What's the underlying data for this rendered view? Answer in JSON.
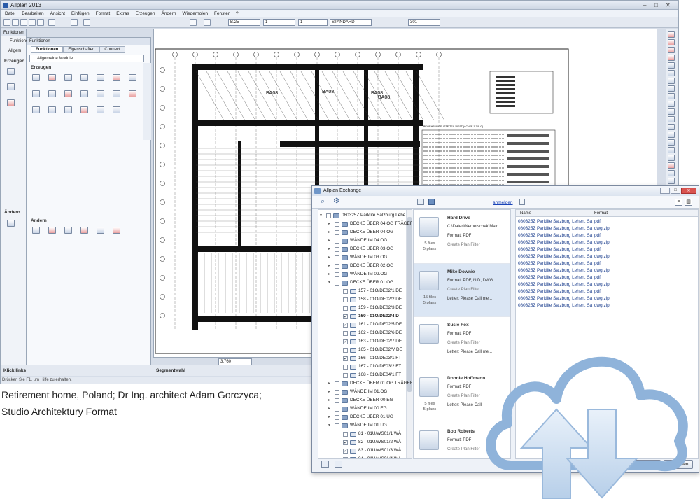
{
  "app": {
    "title": "Allplan 2013",
    "menu": [
      "Datei",
      "Bearbeiten",
      "Ansicht",
      "Einfügen",
      "Format",
      "Extras",
      "Erzeugen",
      "Ändern",
      "Wiederholen",
      "Fenster",
      "?"
    ],
    "toolbar": {
      "pen": "B.25",
      "line": "1",
      "color": "1",
      "layer": "STANDARD",
      "hatch": "301"
    },
    "status_hint": "Drücken Sie F1, um Hilfe zu erhalten.",
    "bottom_left": "Klick links",
    "bottom_mid": "Segmentwahl",
    "scale_value": "3.760"
  },
  "functions_panel": {
    "title": "Funktionen",
    "tab_left": "Funktionen",
    "side_tab": "Allgem",
    "float_title": "Funktionen",
    "tabs": [
      "Funktionen",
      "Eigenschaften",
      "Connect"
    ],
    "module_select": "Allgemeine Module",
    "section_create": "Erzeugen",
    "section_modify": "Ändern"
  },
  "caption": {
    "line1": "Retirement home, Poland; Dr Ing. architect Adam Gorczyca;",
    "line2": "Studio Architektury Format"
  },
  "dialog": {
    "title": "Allplan Exchange",
    "login_link": "anmelden",
    "tree": [
      {
        "label": "080325Z Parklife Salzburg Lehe",
        "level": 0,
        "checked": false,
        "expand": "-",
        "bold": false
      },
      {
        "label": "DECKE ÜBER 04.OG TRÄGER",
        "level": 1,
        "checked": false,
        "expand": "+",
        "bold": false
      },
      {
        "label": "DECKE ÜBER 04.OG",
        "level": 1,
        "checked": false,
        "expand": "+",
        "bold": false
      },
      {
        "label": "WÄNDE IM 04.OG",
        "level": 1,
        "checked": false,
        "expand": "+",
        "bold": false
      },
      {
        "label": "DECKE ÜBER 03.OG",
        "level": 1,
        "checked": false,
        "expand": "+",
        "bold": false
      },
      {
        "label": "WÄNDE IM 03.OG",
        "level": 1,
        "checked": false,
        "expand": "+",
        "bold": false
      },
      {
        "label": "DECKE ÜBER 02.OG",
        "level": 1,
        "checked": false,
        "expand": "+",
        "bold": false
      },
      {
        "label": "WÄNDE IM 02.OG",
        "level": 1,
        "checked": false,
        "expand": "+",
        "bold": false
      },
      {
        "label": "DECKE ÜBER 01.OG",
        "level": 1,
        "checked": false,
        "expand": "-",
        "bold": false
      },
      {
        "label": "157 - 01O/DE02/1 DE",
        "level": 2,
        "checked": false,
        "expand": "",
        "bold": false
      },
      {
        "label": "158 - 01O/DE02/2 DE",
        "level": 2,
        "checked": false,
        "expand": "",
        "bold": false
      },
      {
        "label": "159 - 01O/DE02/3 DE",
        "level": 2,
        "checked": false,
        "expand": "",
        "bold": false
      },
      {
        "label": "160 - 01O/DE02/4 D",
        "level": 2,
        "checked": true,
        "expand": "",
        "bold": true
      },
      {
        "label": "161 - 01O/DE02/5 DE",
        "level": 2,
        "checked": true,
        "expand": "",
        "bold": false
      },
      {
        "label": "162 - 01O/DE02/6 DE",
        "level": 2,
        "checked": false,
        "expand": "",
        "bold": false
      },
      {
        "label": "163 - 01O/DE02/7 DE",
        "level": 2,
        "checked": true,
        "expand": "",
        "bold": false
      },
      {
        "label": "165 - 01O/DE02/V DE",
        "level": 2,
        "checked": false,
        "expand": "",
        "bold": false
      },
      {
        "label": "166 - 01O/DE03/1 FT",
        "level": 2,
        "checked": true,
        "expand": "",
        "bold": false
      },
      {
        "label": "167 - 01O/DE03/2 FT",
        "level": 2,
        "checked": false,
        "expand": "",
        "bold": false
      },
      {
        "label": "168 - 01O/DE04/1 FT",
        "level": 2,
        "checked": false,
        "expand": "",
        "bold": false
      },
      {
        "label": "DECKE ÜBER 01.OG TRÄGER",
        "level": 1,
        "checked": false,
        "expand": "+",
        "bold": false
      },
      {
        "label": "WÄNDE IM 01.OG",
        "level": 1,
        "checked": false,
        "expand": "+",
        "bold": false
      },
      {
        "label": "DECKE ÜBER 00.EG",
        "level": 1,
        "checked": false,
        "expand": "+",
        "bold": false
      },
      {
        "label": "WÄNDE IM 00.EG",
        "level": 1,
        "checked": false,
        "expand": "+",
        "bold": false
      },
      {
        "label": "DECKE ÜBER 01.UG",
        "level": 1,
        "checked": false,
        "expand": "+",
        "bold": false
      },
      {
        "label": "WÄNDE IM 01.UG",
        "level": 1,
        "checked": false,
        "expand": "-",
        "bold": false
      },
      {
        "label": "81 - 01U/WS01/1 WÄ",
        "level": 2,
        "checked": false,
        "expand": "",
        "bold": false
      },
      {
        "label": "82 - 01U/WS01/2 WÄ",
        "level": 2,
        "checked": true,
        "expand": "",
        "bold": false
      },
      {
        "label": "83 - 01U/WS01/3 WÄ",
        "level": 2,
        "checked": true,
        "expand": "",
        "bold": false
      },
      {
        "label": "84 - 01U/WS01/4 WÄ",
        "level": 2,
        "checked": false,
        "expand": "",
        "bold": false
      }
    ],
    "peers": [
      {
        "name": "Hard Drive",
        "lines": [
          "C:\\Daten\\Nemetschek\\Main",
          "Format: PDF",
          "Create Plan Filter"
        ],
        "files": "5 files",
        "plans": "5 plans",
        "selected": false
      },
      {
        "name": "Mike Downie",
        "lines": [
          "Format: PDF, NID, DWG",
          "Create Plan Filter",
          "Letter: Please Call me..."
        ],
        "files": "15 files",
        "plans": "5 plans",
        "selected": true
      },
      {
        "name": "Susie Fox",
        "lines": [
          "Format: PDF",
          "Create Plan Filter",
          "Letter: Please Call me..."
        ],
        "files": "",
        "plans": "",
        "selected": false
      },
      {
        "name": "Donnie Hoffmann",
        "lines": [
          "Format: PDF",
          "Create Plan Filter",
          "Letter: Please Call"
        ],
        "files": "5 files",
        "plans": "5 plans",
        "selected": false
      },
      {
        "name": "Bob Roberts",
        "lines": [
          "Format: PDF",
          "Create Plan Filter"
        ],
        "files": "",
        "plans": "",
        "selected": false
      }
    ],
    "file_columns": [
      "Name",
      "Format"
    ],
    "files": [
      {
        "name": "080325Z Parklife Salzburg Lehen, Sa",
        "format": "pdf"
      },
      {
        "name": "080325Z Parklife Salzburg Lehen, Sa",
        "format": "dwg.zip"
      },
      {
        "name": "080325Z Parklife Salzburg Lehen, Sa",
        "format": "pdf"
      },
      {
        "name": "080325Z Parklife Salzburg Lehen, Sa",
        "format": "dwg.zip"
      },
      {
        "name": "080325Z Parklife Salzburg Lehen, Sa",
        "format": "pdf"
      },
      {
        "name": "080325Z Parklife Salzburg Lehen, Sa",
        "format": "dwg.zip"
      },
      {
        "name": "080325Z Parklife Salzburg Lehen, Sa",
        "format": "pdf"
      },
      {
        "name": "080325Z Parklife Salzburg Lehen, Sa",
        "format": "dwg.zip"
      },
      {
        "name": "080325Z Parklife Salzburg Lehen, Sa",
        "format": "pdf"
      },
      {
        "name": "080325Z Parklife Salzburg Lehen, Sa",
        "format": "dwg.zip"
      },
      {
        "name": "080325Z Parklife Salzburg Lehen, Sa",
        "format": "pdf"
      },
      {
        "name": "080325Z Parklife Salzburg Lehen, Sa",
        "format": "dwg.zip"
      },
      {
        "name": "080325Z Parklife Salzburg Lehen, Sa",
        "format": "dwg.zip"
      }
    ],
    "export_button": "Export...",
    "close_button": "Schließen"
  },
  "drawing": {
    "room_labels": [
      "BA08",
      "BA08",
      "BA08",
      "BA08"
    ],
    "table_title": "BEWEHRUNGSLISTE TEIL WEST (ACHSE 1-7/A-G)"
  },
  "colors": {
    "accent": "#1c3f8e",
    "cloud": "#7ea7d3"
  }
}
